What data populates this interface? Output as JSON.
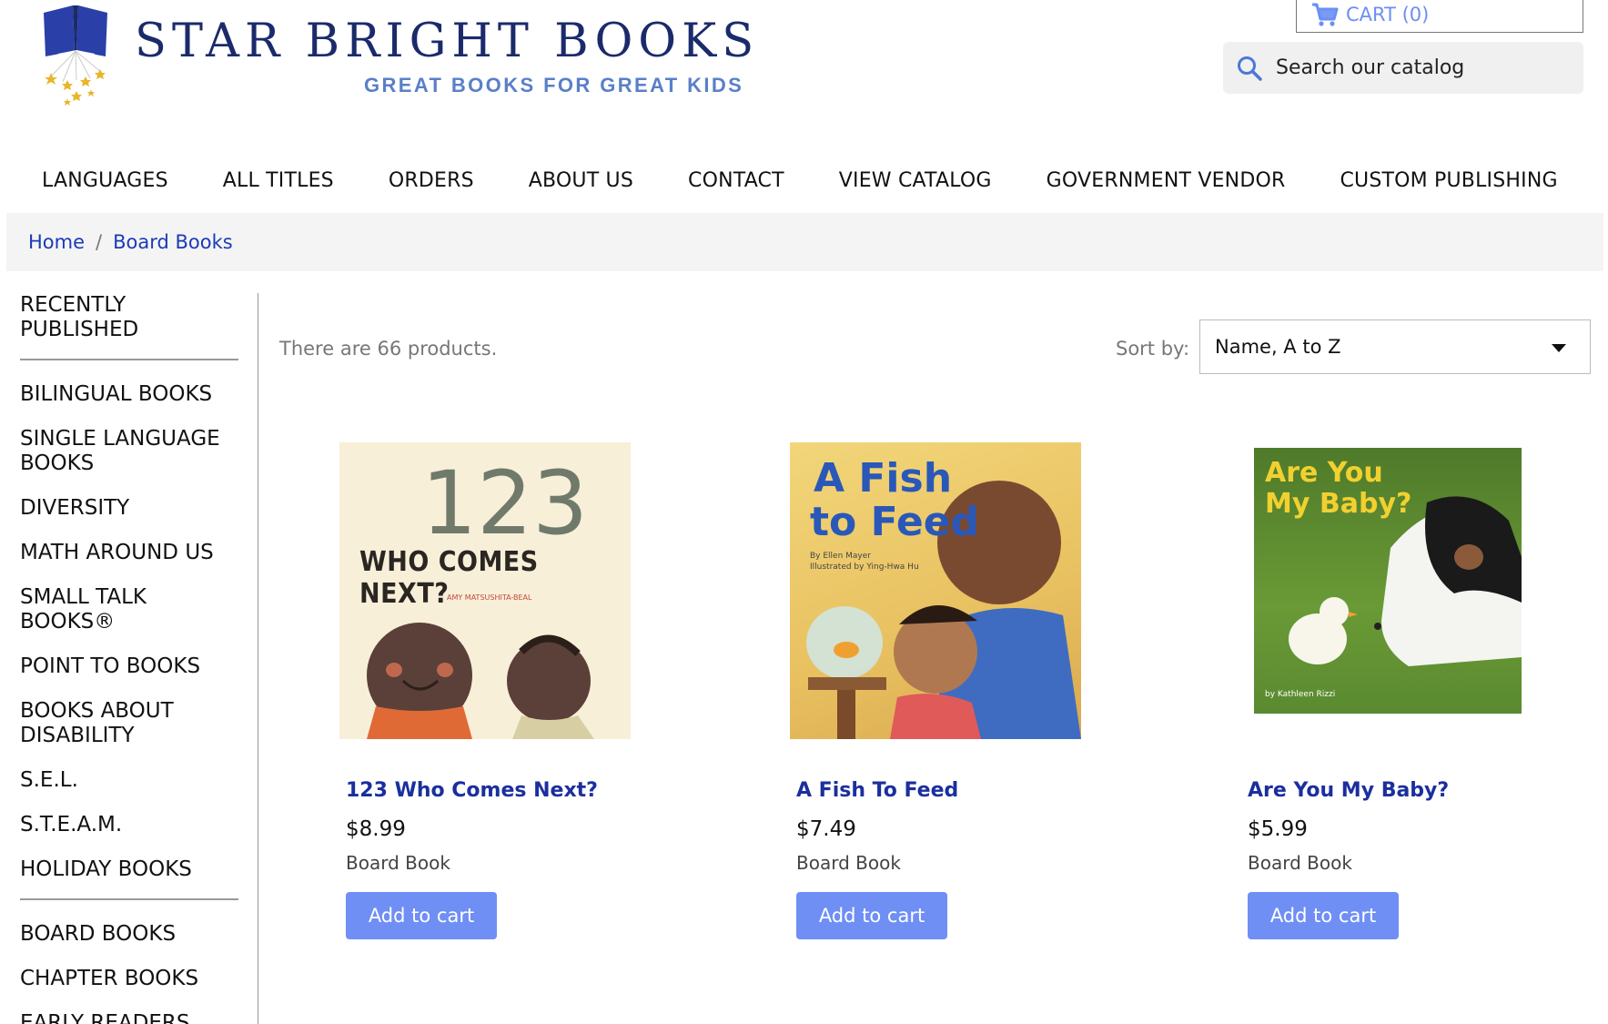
{
  "brand": {
    "name": "STAR BRIGHT BOOKS",
    "tagline": "GREAT BOOKS FOR GREAT KIDS"
  },
  "cart": {
    "label": "CART (0)",
    "icon": "cart-icon"
  },
  "search": {
    "placeholder": "Search our catalog",
    "icon": "search-icon"
  },
  "nav": {
    "items": [
      "LANGUAGES",
      "ALL TITLES",
      "ORDERS",
      "ABOUT US",
      "CONTACT",
      "VIEW CATALOG",
      "GOVERNMENT VENDOR",
      "CUSTOM PUBLISHING"
    ]
  },
  "breadcrumb": {
    "home": "Home",
    "separator": "/",
    "current": "Board Books"
  },
  "sidebar": {
    "group1": [
      "RECENTLY PUBLISHED"
    ],
    "group2": [
      "BILINGUAL BOOKS",
      "SINGLE LANGUAGE BOOKS",
      "DIVERSITY",
      "MATH AROUND US",
      "SMALL TALK BOOKS®",
      "POINT TO BOOKS",
      "BOOKS ABOUT DISABILITY",
      "S.E.L.",
      "S.T.E.A.M.",
      "HOLIDAY BOOKS"
    ],
    "group3": [
      "BOARD BOOKS",
      "CHAPTER BOOKS",
      "EARLY READERS"
    ]
  },
  "listing": {
    "count_text": "There are 66 products.",
    "sort_label": "Sort by:",
    "sort_value": "Name, A to Z"
  },
  "products": [
    {
      "title": "123 Who Comes Next?",
      "price": "$8.99",
      "format": "Board Book",
      "button": "Add to cart",
      "cover": {
        "line1": "123",
        "line2": "WHO COMES NEXT?",
        "author": "AMY MATSUSHITA-BEAL"
      }
    },
    {
      "title": "A Fish To Feed",
      "price": "$7.49",
      "format": "Board Book",
      "button": "Add to cart",
      "cover": {
        "line1": "A Fish",
        "line2": "to Feed",
        "author": "By Ellen Mayer",
        "illustrator": "Illustrated by Ying-Hwa Hu"
      }
    },
    {
      "title": "Are You My Baby?",
      "price": "$5.99",
      "format": "Board Book",
      "button": "Add to cart",
      "cover": {
        "line1": "Are You",
        "line2": "My Baby?",
        "author": "by Kathleen Rizzi"
      }
    }
  ],
  "colors": {
    "brand_navy": "#1b2a6b",
    "tagline_blue": "#5a7fc8",
    "link_blue": "#1b3bb5",
    "button_blue": "#6f8ff5"
  }
}
